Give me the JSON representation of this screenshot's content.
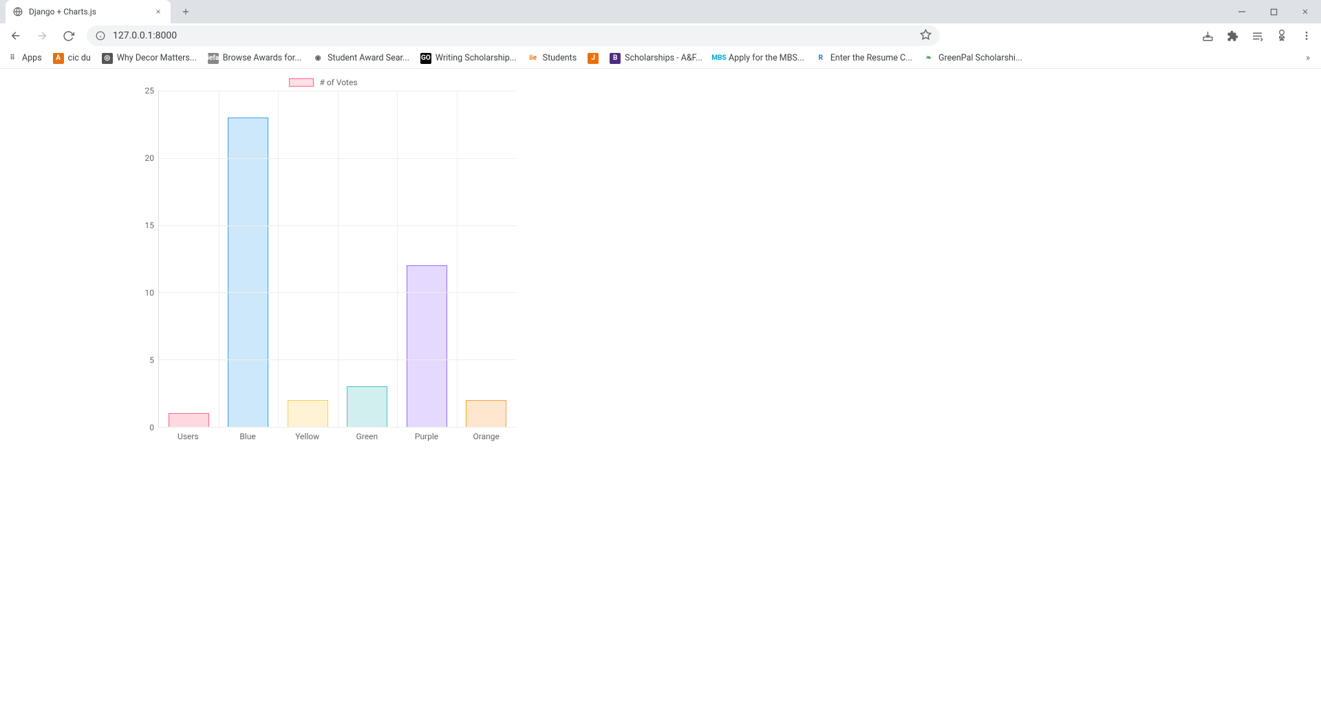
{
  "browser": {
    "tab_title": "Django + Charts.js",
    "url": "127.0.0.1:8000",
    "bookmarks": [
      {
        "label": "Apps",
        "icon_bg": "#fff",
        "icon_fg": "#5f6368",
        "icon_text": "⠿"
      },
      {
        "label": "cic du",
        "icon_bg": "#e8710a",
        "icon_fg": "#fff",
        "icon_text": "A"
      },
      {
        "label": "Why Decor Matters...",
        "icon_bg": "#555",
        "icon_fg": "#fff",
        "icon_text": "◎"
      },
      {
        "label": "Browse Awards for...",
        "icon_bg": "#888",
        "icon_fg": "#fff",
        "icon_text": "iefa"
      },
      {
        "label": "Student Award Sear...",
        "icon_bg": "#fff",
        "icon_fg": "#5f6368",
        "icon_text": "◉"
      },
      {
        "label": "Writing Scholarship...",
        "icon_bg": "#000",
        "icon_fg": "#fff",
        "icon_text": "GO"
      },
      {
        "label": "Students",
        "icon_bg": "#fff",
        "icon_fg": "#e8710a",
        "icon_text": "iie"
      },
      {
        "label": "",
        "icon_bg": "#e8710a",
        "icon_fg": "#fff",
        "icon_text": "J"
      },
      {
        "label": "Scholarships - A&F...",
        "icon_bg": "#4b2e83",
        "icon_fg": "#fff",
        "icon_text": "B"
      },
      {
        "label": "Apply for the MBS...",
        "icon_bg": "#fff",
        "icon_fg": "#00a0dc",
        "icon_text": "MBS"
      },
      {
        "label": "Enter the Resume C...",
        "icon_bg": "#fff",
        "icon_fg": "#1a73e8",
        "icon_text": "R"
      },
      {
        "label": "GreenPal Scholarshi...",
        "icon_bg": "#fff",
        "icon_fg": "#34a853",
        "icon_text": "❧"
      }
    ]
  },
  "chart_data": {
    "type": "bar",
    "legend_label": "# of Votes",
    "categories": [
      "Users",
      "Blue",
      "Yellow",
      "Green",
      "Purple",
      "Orange"
    ],
    "values": [
      1,
      23,
      2,
      3,
      12,
      2
    ],
    "ylim": [
      0,
      25
    ],
    "y_ticks": [
      0,
      5,
      10,
      15,
      20,
      25
    ],
    "colors": [
      {
        "fill": "rgba(255,99,132,0.25)",
        "border": "rgba(255,99,132,1)"
      },
      {
        "fill": "rgba(54,162,235,0.25)",
        "border": "rgba(54,162,235,1)"
      },
      {
        "fill": "rgba(255,206,86,0.25)",
        "border": "rgba(255,206,86,1)"
      },
      {
        "fill": "rgba(75,192,192,0.25)",
        "border": "rgba(75,192,192,1)"
      },
      {
        "fill": "rgba(153,102,255,0.25)",
        "border": "rgba(153,102,255,1)"
      },
      {
        "fill": "rgba(255,159,64,0.25)",
        "border": "rgba(255,159,64,1)"
      }
    ]
  }
}
